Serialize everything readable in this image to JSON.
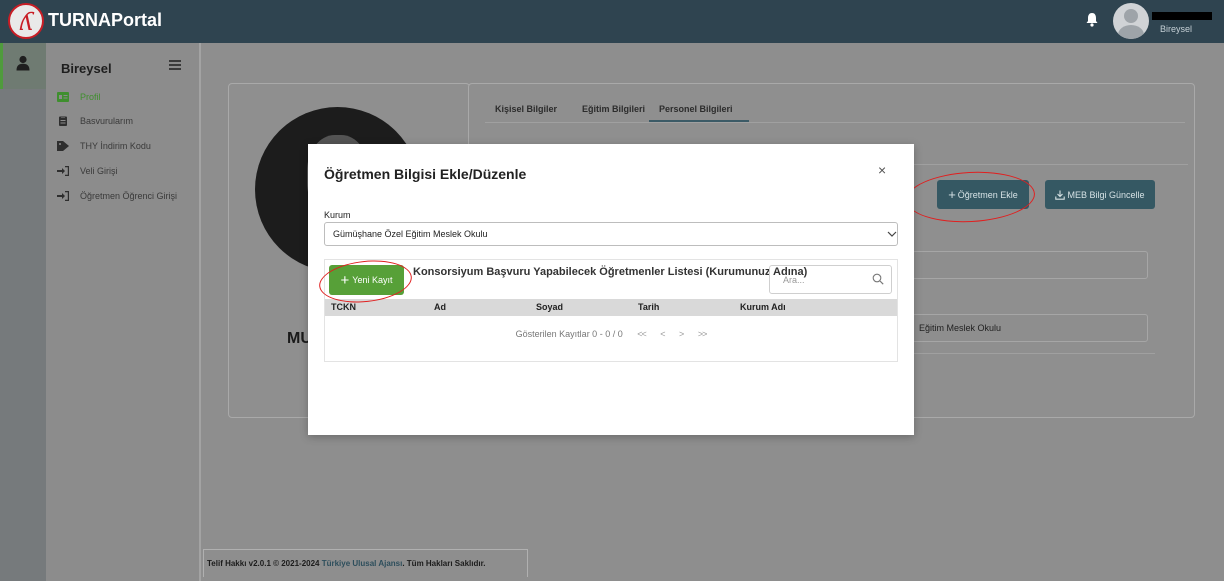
{
  "app": {
    "brand": "TURNAPortal",
    "logo_glyph": "ʎ",
    "user_role": "Bireysel",
    "accent": "#57a038",
    "header_color": "#2f4450"
  },
  "sidebar": {
    "title": "Bireysel",
    "items": [
      {
        "label": "Profil",
        "icon": "id-card-icon"
      },
      {
        "label": "Basvurularım",
        "icon": "clipboard-icon"
      },
      {
        "label": "THY İndirim Kodu",
        "icon": "tag-icon"
      },
      {
        "label": "Veli Girişi",
        "icon": "sign-in-icon"
      },
      {
        "label": "Öğretmen Öğrenci Girişi",
        "icon": "sign-in-icon"
      }
    ]
  },
  "profile": {
    "name_visible": "MU"
  },
  "tabs": [
    {
      "label": "Kişisel Bilgiler"
    },
    {
      "label": "Eğitim Bilgileri"
    },
    {
      "label": "Personel Bilgileri",
      "active": true
    }
  ],
  "actions": {
    "ogretmen_ekle": "Öğretmen Ekle",
    "meb_guncelle": "MEB Bilgi Güncelle"
  },
  "bg_fields": {
    "okul_suffix": "Eğitim Meslek Okulu"
  },
  "modal": {
    "title": "Öğretmen Bilgisi Ekle/Düzenle",
    "close": "×",
    "kurum_label": "Kurum",
    "kurum_value": "Gümüşhane Özel Eğitim Meslek Okulu",
    "new_button": "Yeni Kayıt",
    "new_button_plus": "+",
    "list_title": "Konsorsiyum Başvuru Yapabilecek Öğretmenler Listesi (Kurumunuz Adına)",
    "search_placeholder": "Ara...",
    "columns": [
      "TCKN",
      "Ad",
      "Soyad",
      "Tarih",
      "Kurum Adı"
    ],
    "pager_text": "Gösterilen Kayıtlar 0 - 0 / 0",
    "pager_first": "<<",
    "pager_prev": "<",
    "pager_next": ">",
    "pager_last": ">>"
  },
  "footer": {
    "prefix": "Telif Hakkı v2.0.1 © 2021-2024",
    "link": "Türkiye Ulusal Ajansı",
    "suffix": ". Tüm Hakları Saklıdır."
  }
}
